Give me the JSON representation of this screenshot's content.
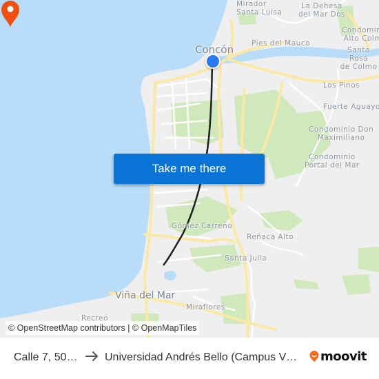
{
  "map": {
    "colors": {
      "water": "#b9ddf8",
      "land": "#efefef",
      "park": "#cfe8bc",
      "road_major": "#fbe8a4",
      "road_minor": "#ffffff",
      "route_line": "#1f1f1f",
      "origin_pin": "#2979f0",
      "dest_pin": "#f0500f"
    },
    "places": [
      {
        "name": "Mirador\nSanta Luisa"
      },
      {
        "name": "La Dehesa\ndel Mar Dos"
      },
      {
        "name": "Condominio\nAlto Colmo"
      },
      {
        "name": "Concón"
      },
      {
        "name": "Pies del Mauco"
      },
      {
        "name": "Santa Rosa\nde Colmo"
      },
      {
        "name": "Los Pinos"
      },
      {
        "name": "Fuerte Aguayo"
      },
      {
        "name": "Condominio Don\nMaximiliano"
      },
      {
        "name": "Condominio\nPortal del Mar"
      },
      {
        "name": "Gómez Carreño"
      },
      {
        "name": "Reñaca Alto"
      },
      {
        "name": "Santa Julia"
      },
      {
        "name": "Viña del Mar"
      },
      {
        "name": "Miraflores"
      },
      {
        "name": "Recreo"
      }
    ],
    "origin_marker": "origin-pin",
    "destination_marker": "destination-pin"
  },
  "cta": {
    "label": "Take me there"
  },
  "attribution": {
    "osm": "© OpenStreetMap contributors",
    "separator": " | ",
    "omt": "© OpenMapTiles"
  },
  "footer": {
    "origin": "Calle 7, 50…",
    "arrow_icon": "arrow-right-icon",
    "destination": "Universidad Andrés Bello (Campus V…",
    "brand": "moovit",
    "brand_color": "#f26b1d"
  }
}
